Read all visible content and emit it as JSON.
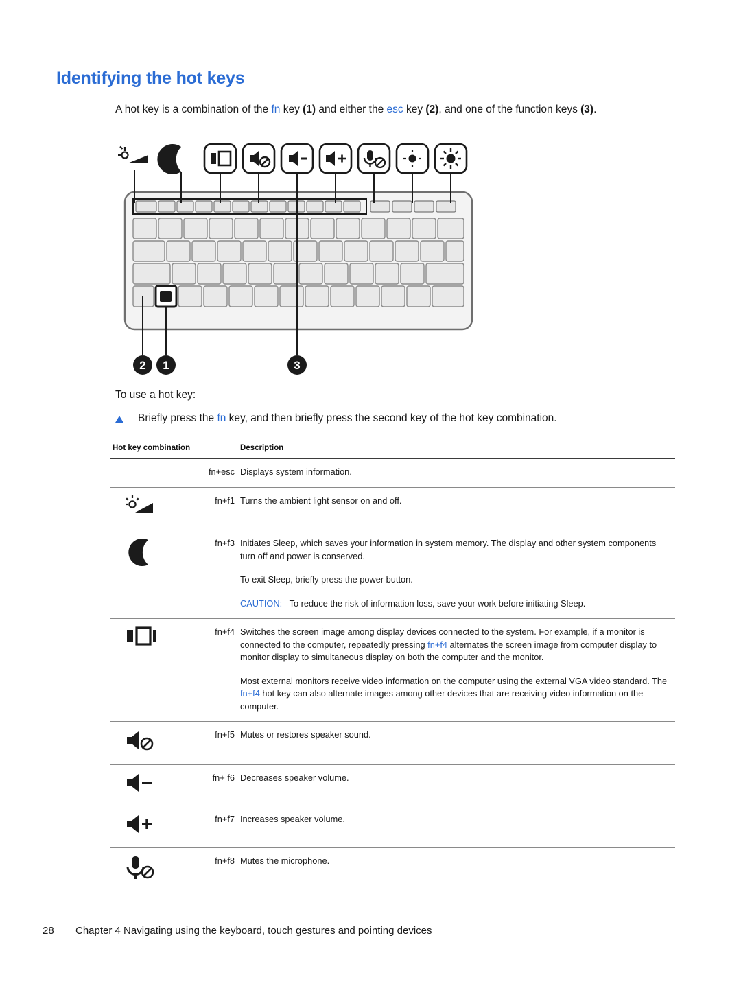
{
  "document": {
    "title": "Identifying the hot keys",
    "intro_parts": {
      "p1": "A hot key is a combination of the ",
      "fn": "fn",
      "p2": " key ",
      "num1": "(1)",
      "p3": " and either the ",
      "esc": "esc",
      "p4": " key ",
      "num2": "(2)",
      "p5": ", and one of the function keys ",
      "num3": "(3)",
      "p6": "."
    },
    "to_use_label": "To use a hot key:",
    "bullet": {
      "pre": "Briefly press the ",
      "key": "fn",
      "post": " key, and then briefly press the second key of the hot key combination."
    },
    "callouts": [
      "2",
      "1",
      "3"
    ]
  },
  "table": {
    "headers": [
      "Hot key combination",
      "Description"
    ],
    "rows": [
      {
        "icon": "none",
        "combo": "fn+esc",
        "desc": [
          "Displays system information."
        ]
      },
      {
        "icon": "ambient-light-sensor-icon",
        "combo": "fn+f1",
        "desc": [
          "Turns the ambient light sensor on and off."
        ]
      },
      {
        "icon": "sleep-moon-icon",
        "combo": "fn+f3",
        "desc": [
          "Initiates Sleep, which saves your information in system memory. The display and other system components turn off and power is conserved.",
          "To exit Sleep, briefly press the power button.",
          "CAUTION:|To reduce the risk of information loss, save your work before initiating Sleep."
        ]
      },
      {
        "icon": "switch-screen-image-icon",
        "combo": "fn+f4",
        "desc": [
          "Switches the screen image among display devices connected to the system. For example, if a monitor is connected to the computer, repeatedly pressing {fn+f4} alternates the screen image from computer display to monitor display to simultaneous display on both the computer and the monitor.",
          "Most external monitors receive video information on the computer using the external VGA video standard. The {fn+f4} hot key can also alternate images among other devices that are receiving video information on the computer."
        ]
      },
      {
        "icon": "mute-speaker-icon",
        "combo": "fn+f5",
        "desc": [
          "Mutes or restores speaker sound."
        ]
      },
      {
        "icon": "volume-down-icon",
        "combo": "fn+ f6",
        "desc": [
          "Decreases speaker volume."
        ]
      },
      {
        "icon": "volume-up-icon",
        "combo": "fn+f7",
        "desc": [
          "Increases speaker volume."
        ]
      },
      {
        "icon": "mute-microphone-icon",
        "combo": "fn+f8",
        "desc": [
          "Mutes the microphone."
        ]
      }
    ]
  },
  "footer": {
    "page_number": "28",
    "chapter": "Chapter 4   Navigating using the keyboard, touch gestures and pointing devices"
  },
  "colors": {
    "accent": "#2b6cd4",
    "text": "#1a1a1a",
    "rule": "#3b3b3b"
  }
}
